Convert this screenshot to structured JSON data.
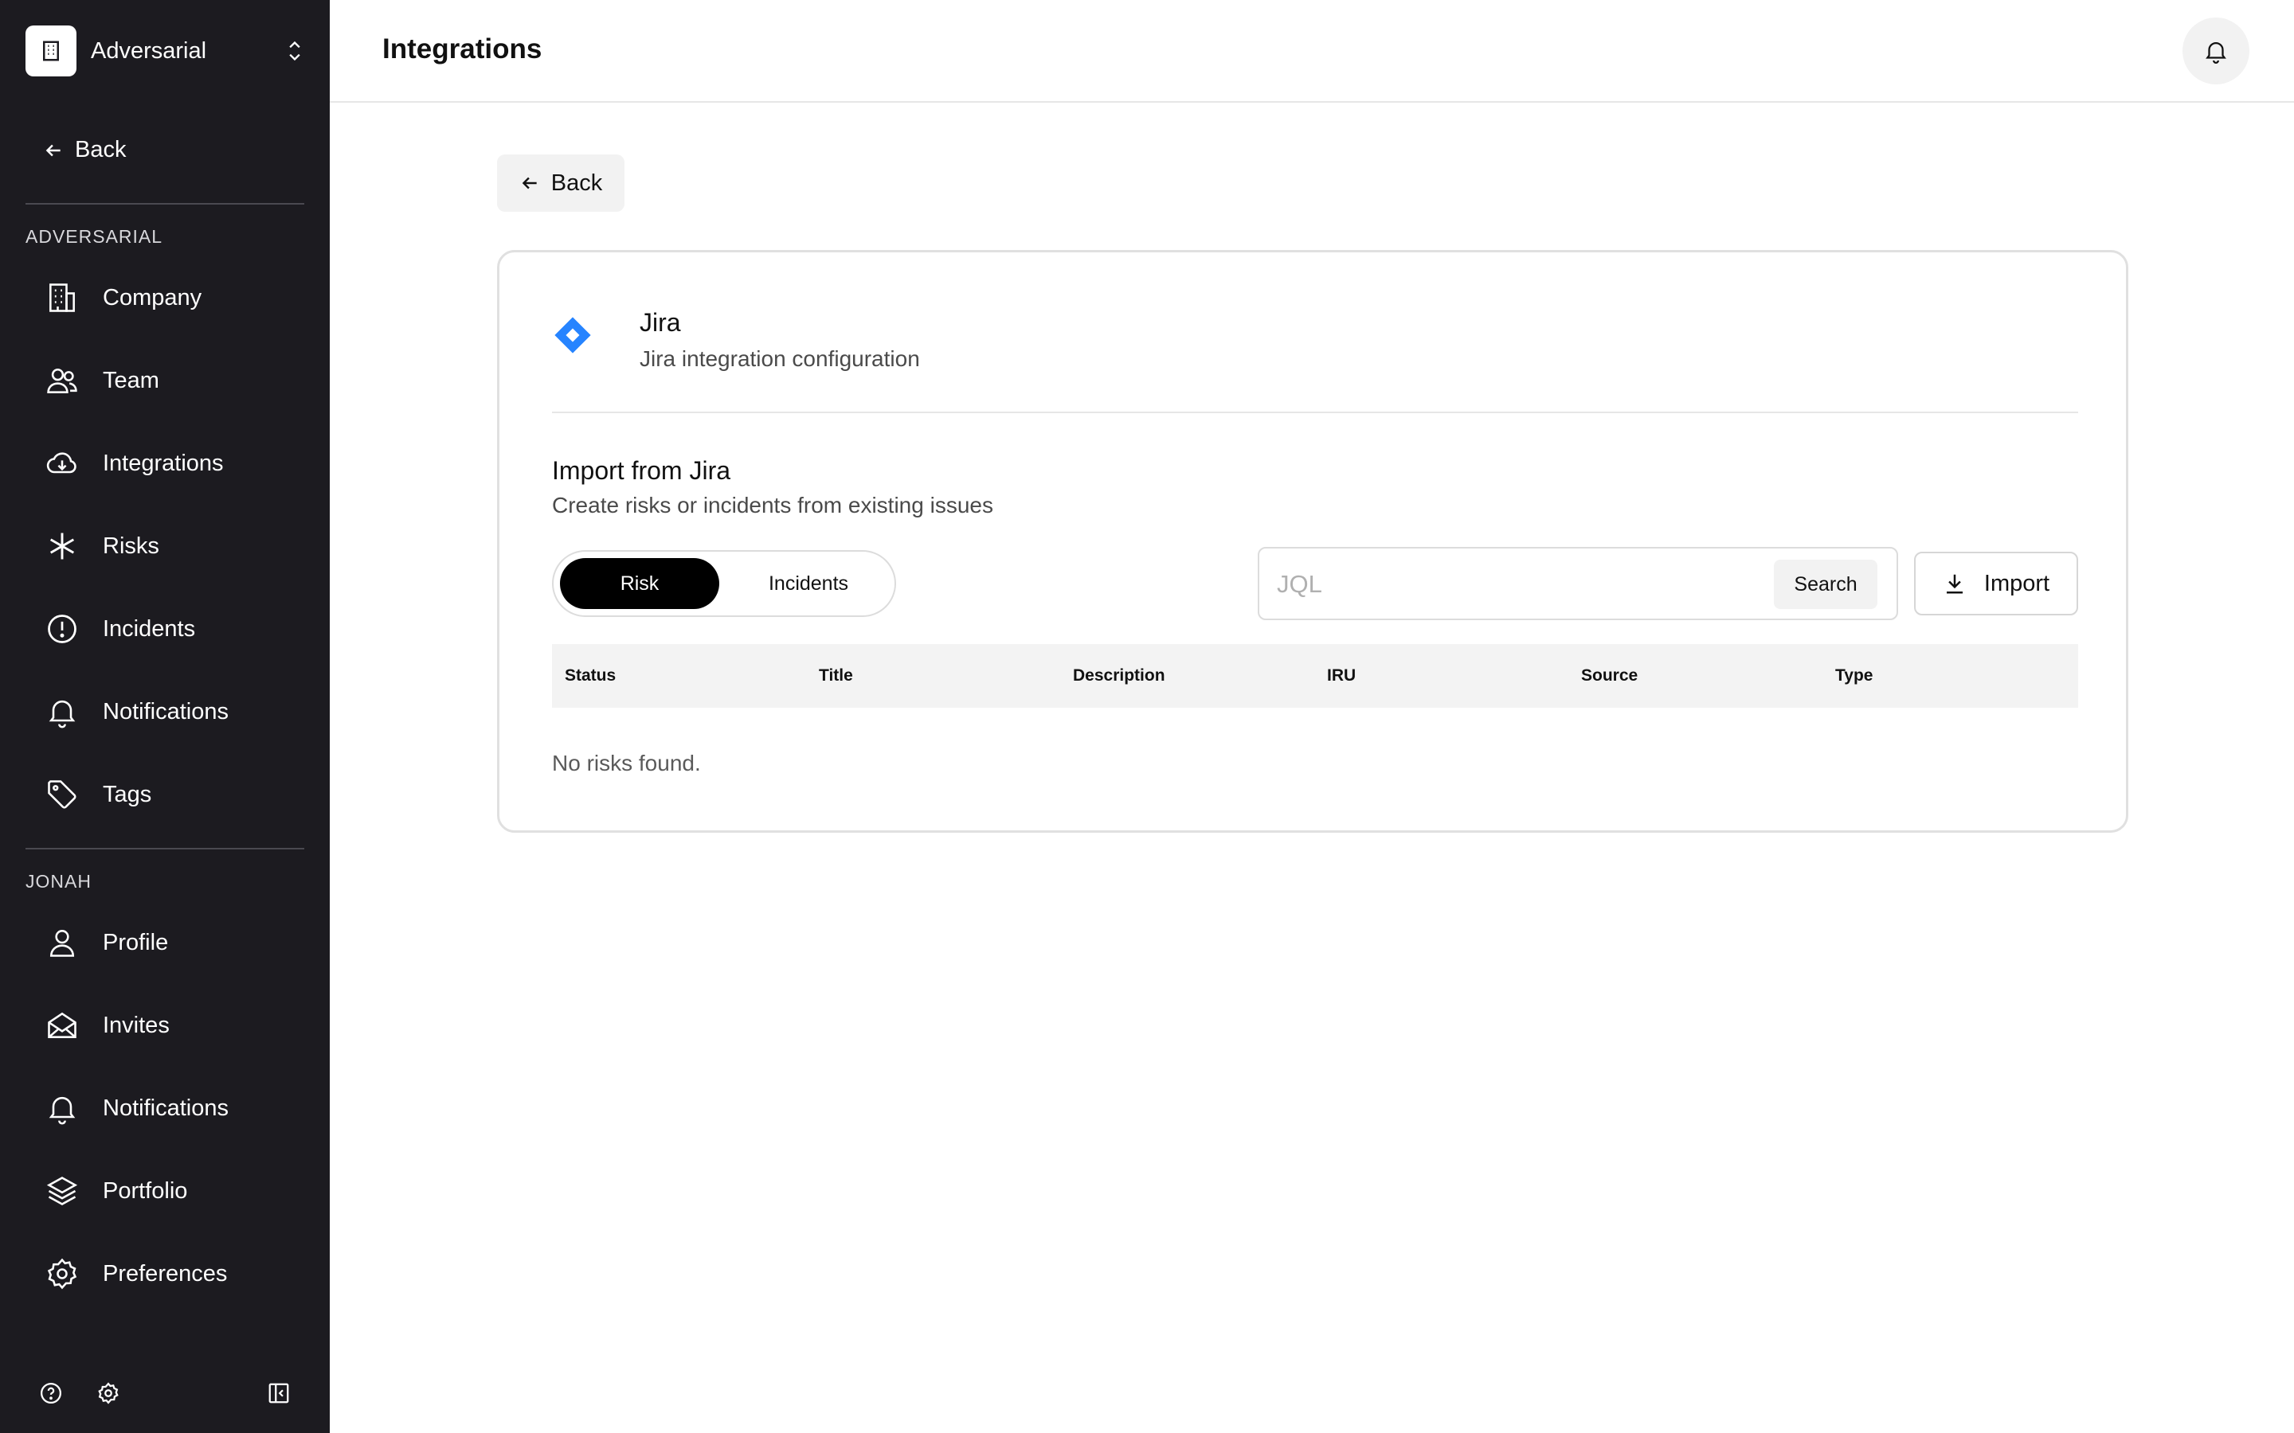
{
  "sidebar": {
    "org_name": "Adversarial",
    "back_label": "Back",
    "section_org": "ADVERSARIAL",
    "org_items": [
      {
        "label": "Company",
        "icon": "building-icon"
      },
      {
        "label": "Team",
        "icon": "users-icon"
      },
      {
        "label": "Integrations",
        "icon": "cloud-download-icon"
      },
      {
        "label": "Risks",
        "icon": "asterisk-icon"
      },
      {
        "label": "Incidents",
        "icon": "alert-circle-icon"
      },
      {
        "label": "Notifications",
        "icon": "bell-icon"
      },
      {
        "label": "Tags",
        "icon": "tag-icon"
      }
    ],
    "section_user": "JONAH",
    "user_items": [
      {
        "label": "Profile",
        "icon": "user-icon"
      },
      {
        "label": "Invites",
        "icon": "mail-open-icon"
      },
      {
        "label": "Notifications",
        "icon": "bell-icon"
      },
      {
        "label": "Portfolio",
        "icon": "layers-icon"
      },
      {
        "label": "Preferences",
        "icon": "gear-icon"
      }
    ],
    "footer_icons": [
      "help-icon",
      "gear-icon",
      "collapse-sidebar-icon"
    ]
  },
  "header": {
    "title": "Integrations"
  },
  "main": {
    "back_label": "Back",
    "integration": {
      "name": "Jira",
      "description": "Jira integration configuration"
    },
    "import": {
      "title": "Import from Jira",
      "subtitle": "Create risks or incidents from existing issues",
      "toggle": {
        "risk": "Risk",
        "incidents": "Incidents",
        "selected": "Risk"
      },
      "jql_placeholder": "JQL",
      "search_label": "Search",
      "import_label": "Import"
    },
    "table": {
      "columns": [
        "Status",
        "Title",
        "Description",
        "IRU",
        "Source",
        "Type"
      ],
      "empty_message": "No risks found."
    }
  },
  "colors": {
    "sidebar_bg": "#1c1b20",
    "jira_blue": "#2684ff",
    "selected_toggle": "#000000"
  }
}
